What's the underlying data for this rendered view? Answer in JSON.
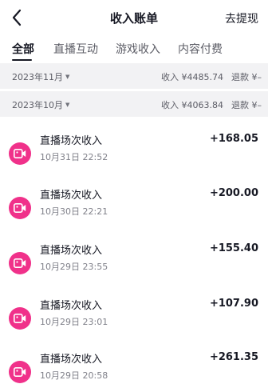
{
  "header": {
    "title": "收入账单",
    "withdraw_label": "去提现"
  },
  "tabs": [
    {
      "label": "全部",
      "active": true
    },
    {
      "label": "直播互动",
      "active": false
    },
    {
      "label": "游戏收入",
      "active": false
    },
    {
      "label": "内容付费",
      "active": false
    }
  ],
  "months": [
    {
      "label": "2023年11月",
      "income": "收入 ¥4485.74",
      "refund": "退款 ¥–"
    },
    {
      "label": "2023年10月",
      "income": "收入 ¥4063.84",
      "refund": "退款 ¥–"
    }
  ],
  "entries": [
    {
      "title": "直播场次收入",
      "time": "10月31日 22:52",
      "amount": "+168.05"
    },
    {
      "title": "直播场次收入",
      "time": "10月30日 22:21",
      "amount": "+200.00"
    },
    {
      "title": "直播场次收入",
      "time": "10月29日 23:55",
      "amount": "+155.40"
    },
    {
      "title": "直播场次收入",
      "time": "10月29日 23:01",
      "amount": "+107.90"
    },
    {
      "title": "直播场次收入",
      "time": "10月29日 20:58",
      "amount": "+261.35"
    }
  ],
  "icons": {
    "back": "chevron-left-icon",
    "entry": "video-camera-icon",
    "month_toggle": "caret-down-icon"
  },
  "colors": {
    "icon_bg": "#f0318a",
    "section_bg": "#f2f2f4",
    "text_primary": "#161823",
    "text_secondary": "#80818a"
  }
}
